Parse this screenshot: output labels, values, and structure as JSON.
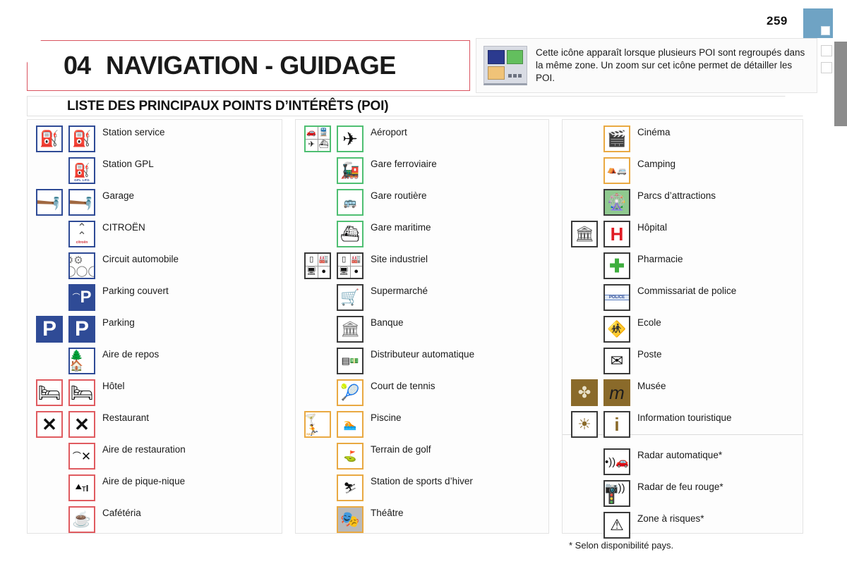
{
  "page": {
    "number": "259"
  },
  "chapter": {
    "number": "04",
    "title": "NAVIGATION - GUIDAGE"
  },
  "note": {
    "icon": "grouped-poi-icon",
    "text": "Cette icône apparaît lorsque plusieurs POI sont regroupés dans la même zone. Un zoom sur cet icône permet de détailler les POI."
  },
  "section": {
    "title": "LISTE DES PRINCIPAUX POINTS D’INTÉRÊTS (POI)"
  },
  "footnote": "* Selon disponibilité pays.",
  "colors": {
    "service_blue": "#2f4b96",
    "hotel_red": "#e05b60",
    "transport_green": "#4fbf72",
    "commerce_dark": "#3a3a3a",
    "leisure_orange": "#e9a942",
    "culture_brown": "#8a6a2a",
    "accent_red": "#d9535f",
    "tab_blue": "#6fa3c4"
  },
  "columns": [
    {
      "id": "column-1",
      "items": [
        {
          "label": "Station service",
          "icon": "fuel-pump-icon",
          "grouped": true
        },
        {
          "label": "Station GPL",
          "icon": "lpg-pump-icon",
          "grouped": false,
          "caption": "GPL LPG"
        },
        {
          "label": "Garage",
          "icon": "wrench-icon",
          "grouped": true
        },
        {
          "label": "CITROËN",
          "icon": "citroen-logo-icon",
          "grouped": false,
          "caption": "citroën"
        },
        {
          "label": "Circuit automobile",
          "icon": "race-circuit-icon",
          "grouped": false
        },
        {
          "label": "Parking couvert",
          "icon": "covered-parking-icon",
          "grouped": false
        },
        {
          "label": "Parking",
          "icon": "parking-icon",
          "grouped": true
        },
        {
          "label": "Aire de repos",
          "icon": "rest-area-icon",
          "grouped": false
        },
        {
          "label": "Hôtel",
          "icon": "bed-icon",
          "grouped": true
        },
        {
          "label": "Restaurant",
          "icon": "cutlery-icon",
          "grouped": true
        },
        {
          "label": "Aire de restauration",
          "icon": "food-court-icon",
          "grouped": false
        },
        {
          "label": "Aire de pique-nique",
          "icon": "picnic-area-icon",
          "grouped": false
        },
        {
          "label": "Cafétéria",
          "icon": "coffee-cup-icon",
          "grouped": false
        }
      ]
    },
    {
      "id": "column-2",
      "items": [
        {
          "label": "Aéroport",
          "icon": "airplane-icon",
          "grouped": true
        },
        {
          "label": "Gare ferroviaire",
          "icon": "train-icon",
          "grouped": false
        },
        {
          "label": "Gare routière",
          "icon": "bus-icon",
          "grouped": false
        },
        {
          "label": "Gare maritime",
          "icon": "ferry-icon",
          "grouped": false
        },
        {
          "label": "Site industriel",
          "icon": "industrial-site-icon",
          "grouped": true
        },
        {
          "label": "Supermarché",
          "icon": "shopping-cart-icon",
          "grouped": false
        },
        {
          "label": "Banque",
          "icon": "bank-icon",
          "grouped": false
        },
        {
          "label": "Distributeur automatique",
          "icon": "atm-icon",
          "grouped": false
        },
        {
          "label": "Court de tennis",
          "icon": "tennis-icon",
          "grouped": false
        },
        {
          "label": "Piscine",
          "icon": "swimming-icon",
          "grouped": true
        },
        {
          "label": "Terrain de golf",
          "icon": "golf-icon",
          "grouped": false
        },
        {
          "label": "Station de sports d’hiver",
          "icon": "ski-icon",
          "grouped": false
        },
        {
          "label": "Théâtre",
          "icon": "theatre-icon",
          "grouped": false
        }
      ]
    },
    {
      "id": "column-3",
      "items": [
        {
          "label": "Cinéma",
          "icon": "film-projector-icon",
          "grouped": false
        },
        {
          "label": "Camping",
          "icon": "camping-icon",
          "grouped": false
        },
        {
          "label": "Parcs d’attractions",
          "icon": "amusement-park-icon",
          "grouped": false
        },
        {
          "label": "Hôpital",
          "icon": "hospital-icon",
          "grouped": true
        },
        {
          "label": "Pharmacie",
          "icon": "pharmacy-cross-icon",
          "grouped": false
        },
        {
          "label": "Commissariat de police",
          "icon": "police-icon",
          "grouped": false,
          "caption": "POLICE"
        },
        {
          "label": "Ecole",
          "icon": "school-icon",
          "grouped": false
        },
        {
          "label": "Poste",
          "icon": "post-envelope-icon",
          "grouped": false
        },
        {
          "label": "Musée",
          "icon": "museum-icon",
          "grouped": true
        },
        {
          "label": "Information touristique",
          "icon": "tourist-info-icon",
          "grouped": true
        },
        {
          "label": "Radar automatique*",
          "icon": "speed-camera-icon",
          "grouped": false
        },
        {
          "label": "Radar de feu rouge*",
          "icon": "red-light-camera-icon",
          "grouped": false
        },
        {
          "label": "Zone à risques*",
          "icon": "risk-zone-icon",
          "grouped": false
        }
      ]
    }
  ]
}
